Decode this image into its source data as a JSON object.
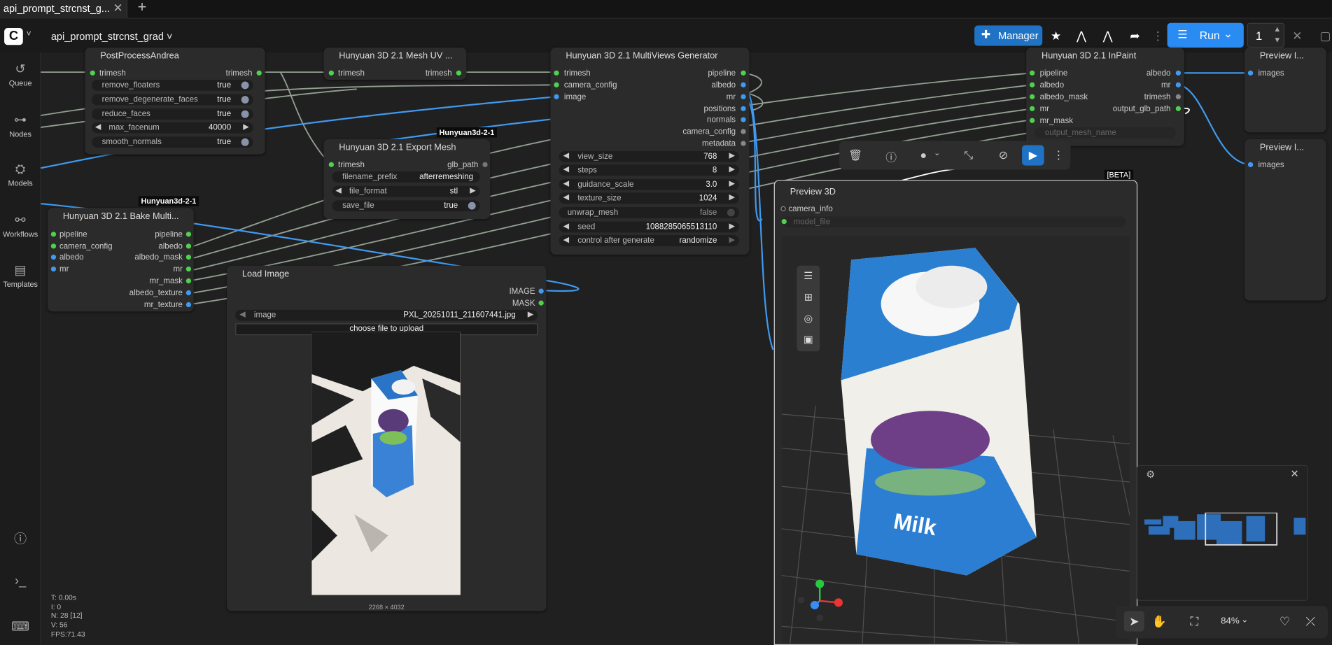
{
  "tab": {
    "title": "api_prompt_strcnst_g...",
    "close": "✕",
    "add": "+"
  },
  "topbar": {
    "workflow_name": "api_prompt_strcnst_grad ˅",
    "manager_label": "Manager",
    "run_label": "Run",
    "run_count": "1"
  },
  "sidebar": [
    {
      "label": "Queue",
      "icon": "history-icon"
    },
    {
      "label": "Nodes",
      "icon": "nodes-icon"
    },
    {
      "label": "Models",
      "icon": "models-icon"
    },
    {
      "label": "Workflows",
      "icon": "workflows-icon"
    },
    {
      "label": "Templates",
      "icon": "templates-icon"
    }
  ],
  "group_tags": [
    "Hunyuan3d-2-1",
    "Hunyuan3d-2-1"
  ],
  "nodes": {
    "postprocess": {
      "title": "PostProcessAndrea",
      "input": "trimesh",
      "output": "trimesh",
      "widgets": [
        {
          "label": "remove_floaters",
          "value": "true"
        },
        {
          "label": "remove_degenerate_faces",
          "value": "true"
        },
        {
          "label": "reduce_faces",
          "value": "true"
        },
        {
          "label": "max_facenum",
          "value": "40000"
        },
        {
          "label": "smooth_normals",
          "value": "true"
        }
      ]
    },
    "meshuv": {
      "title": "Hunyuan 3D 2.1 Mesh UV ...",
      "input": "trimesh",
      "output": "trimesh"
    },
    "export": {
      "title": "Hunyuan 3D 2.1 Export Mesh",
      "input": "trimesh",
      "output": "glb_path",
      "widgets": [
        {
          "label": "filename_prefix",
          "value": "afterremeshing"
        },
        {
          "label": "file_format",
          "value": "stl"
        },
        {
          "label": "save_file",
          "value": "true"
        }
      ]
    },
    "multiviews": {
      "title": "Hunyuan 3D 2.1 MultiViews Generator",
      "inputs": [
        "trimesh",
        "camera_config",
        "image"
      ],
      "outputs": [
        "pipeline",
        "albedo",
        "mr",
        "positions",
        "normals",
        "camera_config",
        "metadata"
      ],
      "widgets": [
        {
          "label": "view_size",
          "value": "768"
        },
        {
          "label": "steps",
          "value": "8"
        },
        {
          "label": "guidance_scale",
          "value": "3.0"
        },
        {
          "label": "texture_size",
          "value": "1024"
        },
        {
          "label": "unwrap_mesh",
          "value": "false"
        },
        {
          "label": "seed",
          "value": "1088285065513110"
        },
        {
          "label": "control after generate",
          "value": "randomize"
        }
      ]
    },
    "inpaint": {
      "title": "Hunyuan 3D 2.1 InPaint",
      "inputs": [
        "pipeline",
        "albedo",
        "albedo_mask",
        "mr",
        "mr_mask"
      ],
      "outputs": [
        "albedo",
        "mr",
        "trimesh",
        "output_glb_path"
      ],
      "placeholder": "output_mesh_name"
    },
    "bake": {
      "title": "Hunyuan 3D 2.1 Bake Multi...",
      "inputs": [
        "pipeline",
        "camera_config",
        "albedo",
        "mr"
      ],
      "outputs": [
        "pipeline",
        "albedo",
        "albedo_mask",
        "mr",
        "mr_mask",
        "albedo_texture",
        "mr_texture"
      ]
    },
    "loadimage": {
      "title": "Load Image",
      "outputs": [
        "IMAGE",
        "MASK"
      ],
      "image_label": "image",
      "image_value": "PXL_20251011_211607441.jpg",
      "upload_label": "choose file to upload",
      "dimensions": "2268 × 4032"
    },
    "preview3d": {
      "title": "Preview 3D",
      "beta": "[BETA]",
      "inputs": [
        "camera_info"
      ],
      "model_file": "model_file"
    },
    "preview_a": {
      "title": "Preview I...",
      "input": "images"
    },
    "preview_b": {
      "title": "Preview I...",
      "input": "images"
    }
  },
  "zoom": "84%",
  "stats": [
    "T: 0.00s",
    "I: 0",
    "N: 28 [12]",
    "V: 56",
    "FPS:71.43"
  ],
  "colors": {
    "accent": "#1f72c4",
    "run": "#2a8bf2",
    "link_blue": "#3f9af0",
    "link_gray": "#a7b7a7",
    "slot_green": "#4fd14f",
    "slot_blue": "#3f9af0"
  }
}
